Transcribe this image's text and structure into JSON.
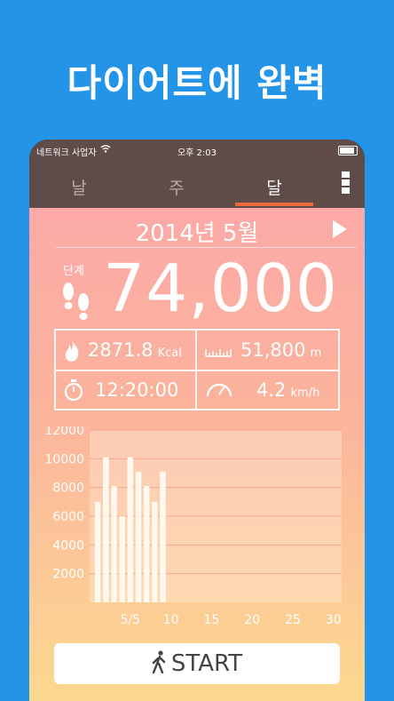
{
  "headline": "다이어트에 완벽",
  "status": {
    "carrier": "네트워크 사업자",
    "time": "오후 2:03"
  },
  "tabs": [
    {
      "label": "날",
      "active": false
    },
    {
      "label": "주",
      "active": false
    },
    {
      "label": "달",
      "active": true
    }
  ],
  "period_title": "2014년 5월",
  "steps": {
    "label": "단계",
    "value": "74,000"
  },
  "stats": {
    "calories": {
      "value": "2871.8",
      "unit": "Kcal"
    },
    "distance": {
      "value": "51,800",
      "unit": "m"
    },
    "duration": {
      "value": "12:20:00"
    },
    "speed": {
      "value": "4.2",
      "unit": "km/h"
    }
  },
  "start_button": "START",
  "colors": {
    "background": "#2494e8",
    "topbar": "#5f4b48",
    "tab_indicator": "#ef6a3a",
    "active_tab": "#ffffff"
  },
  "chart_data": {
    "type": "bar",
    "ylim": [
      0,
      12000
    ],
    "yticks": [
      2000,
      4000,
      6000,
      8000,
      10000,
      12000
    ],
    "xlim": [
      0,
      31
    ],
    "xticks": [
      "5/5",
      "10",
      "15",
      "20",
      "25",
      "30"
    ],
    "xtick_values": [
      5,
      10,
      15,
      20,
      25,
      30
    ],
    "x": [
      1,
      2,
      3,
      4,
      5,
      6,
      7,
      8,
      9
    ],
    "values": [
      7000,
      10100,
      8100,
      6000,
      10100,
      9100,
      8100,
      7000,
      9100
    ],
    "grid": true
  }
}
